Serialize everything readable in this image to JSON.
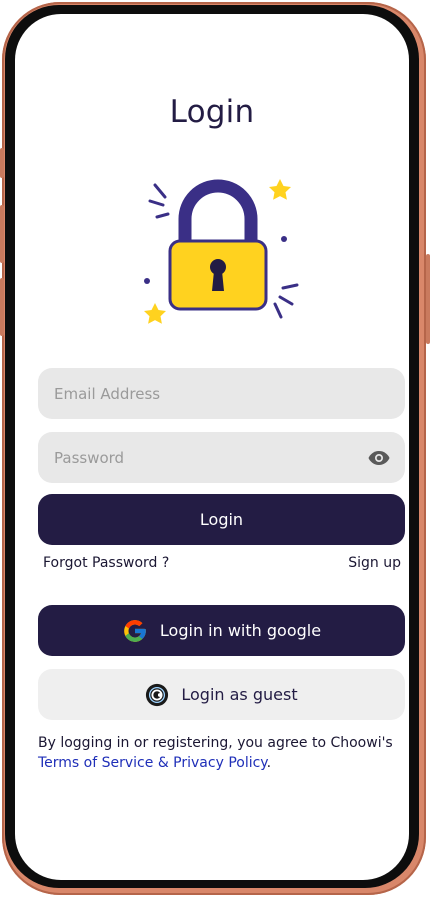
{
  "screen": {
    "title": "Login"
  },
  "form": {
    "email_placeholder": "Email Address",
    "password_placeholder": "Password",
    "login_label": "Login",
    "forgot_password_label": "Forgot Password ?",
    "signup_label": "Sign up"
  },
  "social": {
    "google_label": "Login in with google",
    "guest_label": "Login as guest"
  },
  "legal": {
    "prefix": "By logging in or registering, you agree to Choowi's",
    "link": "Terms of Service & Privacy Policy",
    "suffix": "."
  },
  "icons": {
    "lock": "padlock-illustration",
    "eye": "eye-icon",
    "google": "google-icon",
    "guest": "guest-avatar-icon"
  },
  "colors": {
    "primary": "#231c44",
    "input_bg": "#e8e8e8",
    "guest_bg": "#efefef",
    "lock_yellow": "#ffd21f",
    "lock_outline": "#3a2f86",
    "star_yellow": "#ffd21f",
    "link": "#1f2fb8",
    "frame": "#d9876a"
  }
}
